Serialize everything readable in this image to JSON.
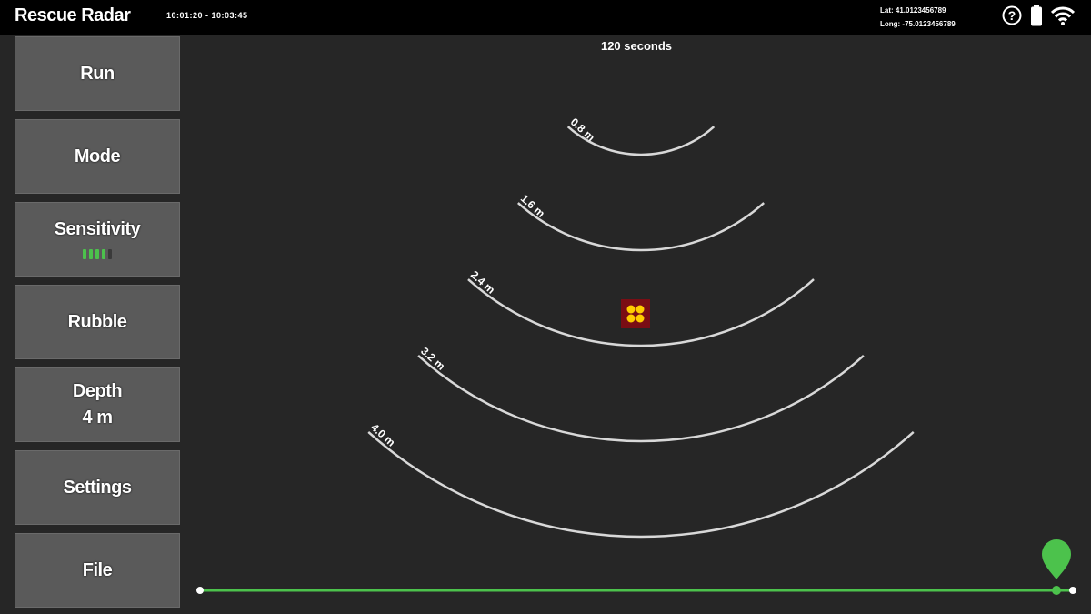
{
  "header": {
    "title": "Rescue Radar",
    "time_range": "10:01:20 - 10:03:45",
    "lat": "Lat: 41.0123456789",
    "long": "Long: -75.0123456789"
  },
  "status_icons": [
    "help-icon",
    "battery-icon",
    "wifi-icon"
  ],
  "sidebar": {
    "run": "Run",
    "mode": "Mode",
    "sensitivity": "Sensitivity",
    "sensitivity_level": 0.8,
    "rubble": "Rubble",
    "depth": "Depth",
    "depth_value": "4 m",
    "settings": "Settings",
    "file": "File"
  },
  "radar": {
    "timer": "120 seconds",
    "rings": [
      {
        "label": "0.8 m"
      },
      {
        "label": "1.6 m"
      },
      {
        "label": "2.4 m"
      },
      {
        "label": "3.2 m"
      },
      {
        "label": "4.0 m"
      }
    ],
    "target": {
      "depth_m": 2.1,
      "lateral_m": 0.0
    }
  },
  "timeline": {
    "position": 1.0
  },
  "colors": {
    "accent": "#4cc24c",
    "target_outer": "#7a0d14",
    "target_inner": "#ffcc00",
    "ring": "#d8d8d8"
  }
}
